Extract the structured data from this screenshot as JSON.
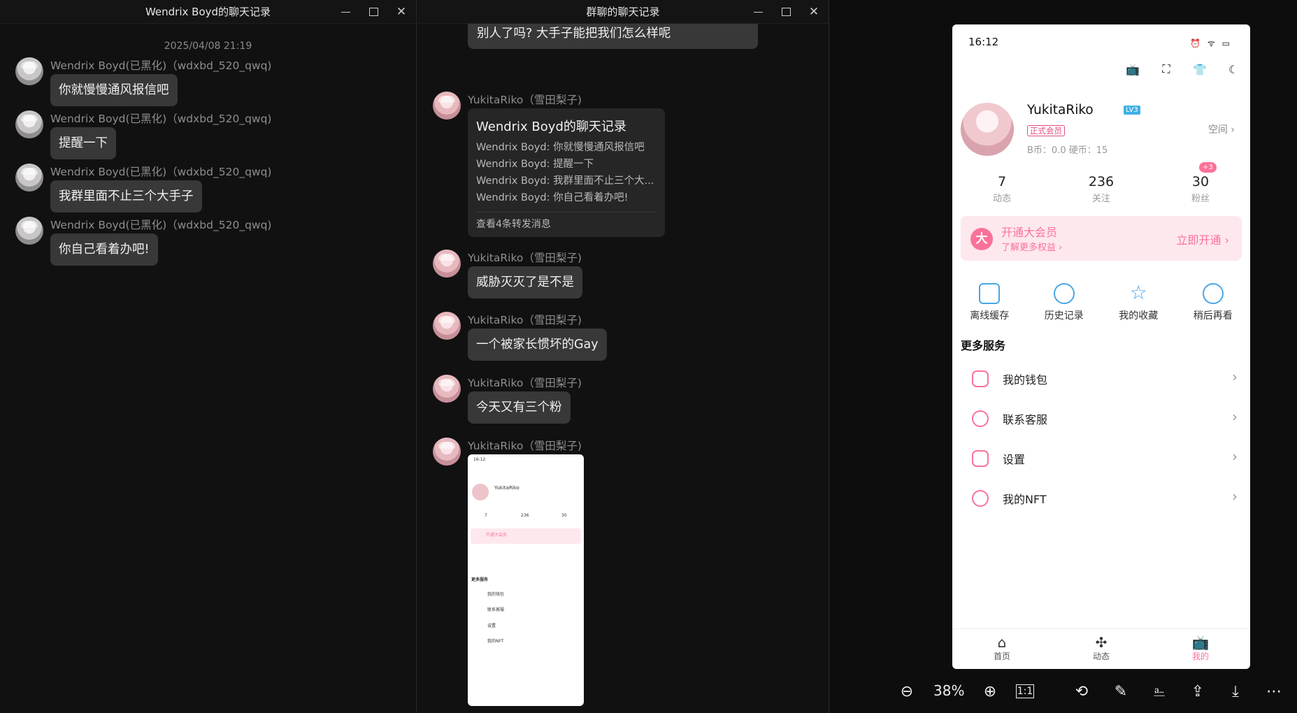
{
  "win1": {
    "title": "Wendrix Boyd的聊天记录",
    "date": "2025/04/08 21:19",
    "messages": [
      {
        "sender": "Wendrix Boyd(已黑化)（wdxbd_520_qwq)",
        "text": "你就慢慢通风报信吧"
      },
      {
        "sender": "Wendrix Boyd(已黑化)（wdxbd_520_qwq)",
        "text": "提醒一下"
      },
      {
        "sender": "Wendrix Boyd(已黑化)（wdxbd_520_qwq)",
        "text": "我群里面不止三个大手子"
      },
      {
        "sender": "Wendrix Boyd(已黑化)（wdxbd_520_qwq)",
        "text": "你自己看着办吧!"
      }
    ]
  },
  "win2": {
    "title": "群聊的聊天记录",
    "top_msg": "@Wendrix Boyd 主播不是退网了吗? Kor不是给别人了吗? 大手子能把我们怎么样呢",
    "sender": "YukitaRiko（雪田梨子)",
    "forward": {
      "title": "Wendrix Boyd的聊天记录",
      "lines": [
        "Wendrix Boyd: 你就慢慢通风报信吧",
        "Wendrix Boyd: 提醒一下",
        "Wendrix Boyd: 我群里面不止三个大...",
        "Wendrix Boyd: 你自己看着办吧!"
      ],
      "footer": "查看4条转发消息"
    },
    "messages": [
      "威胁灭灭了是不是",
      "一个被家长惯坏的Gay",
      "今天又有三个粉"
    ],
    "thumb": {
      "time": "16:12",
      "name": "YukitaRiko",
      "s1": "7",
      "s2": "236",
      "s3": "30",
      "vip": "开通大会员",
      "more": "更多服务",
      "items": [
        "我的钱包",
        "联系客服",
        "设置",
        "我的NFT"
      ]
    }
  },
  "phone": {
    "time": "16:12",
    "status_icons": "⏰ ᯤ ▭",
    "username": "YukitaRiko",
    "level": "LV3",
    "member": "正式会员",
    "coins": "B币：0.0  硬币：15",
    "space": "空间",
    "stats": [
      {
        "n": "7",
        "l": "动态"
      },
      {
        "n": "236",
        "l": "关注"
      },
      {
        "n": "30",
        "l": "粉丝"
      }
    ],
    "plus": "+3",
    "vip_title": "开通大会员",
    "vip_sub": "了解更多权益 ›",
    "vip_btn": "立即开通 ›",
    "quick": [
      "离线缓存",
      "历史记录",
      "我的收藏",
      "稍后再看"
    ],
    "more": "更多服务",
    "services": [
      "我的钱包",
      "联系客服",
      "设置",
      "我的NFT"
    ],
    "tabs": [
      "首页",
      "动态",
      "我的"
    ]
  },
  "viewer": {
    "zoom": "38%",
    "oneone": "1:1"
  }
}
